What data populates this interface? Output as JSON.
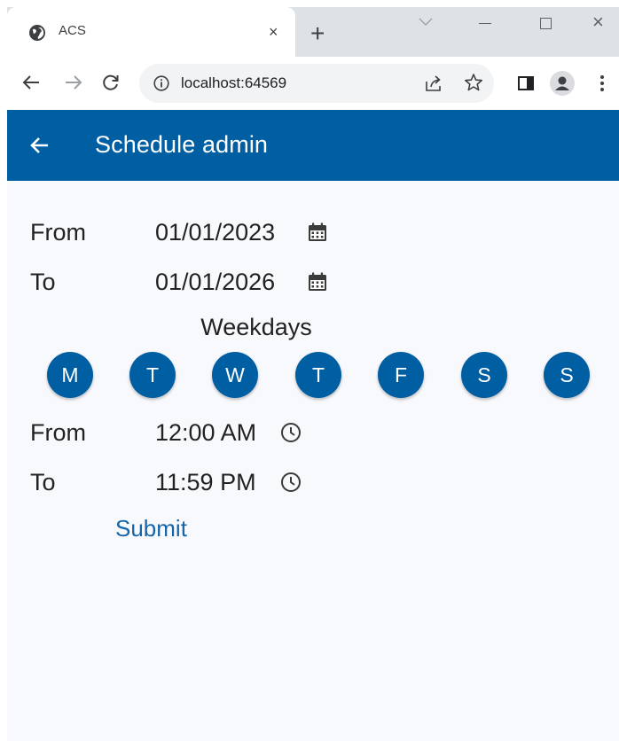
{
  "browser": {
    "tab_title": "ACS",
    "tab_close": "×",
    "new_tab": "+",
    "window_close": "×",
    "url": "localhost:64569"
  },
  "app": {
    "title": "Schedule admin",
    "date_from": {
      "label": "From",
      "value": "01/01/2023",
      "icon": "calendar-icon"
    },
    "date_to": {
      "label": "To",
      "value": "01/01/2026",
      "icon": "calendar-icon"
    },
    "weekdays": {
      "title": "Weekdays",
      "days": [
        "M",
        "T",
        "W",
        "T",
        "F",
        "S",
        "S"
      ]
    },
    "time_from": {
      "label": "From",
      "value": "12:00 AM",
      "icon": "clock-icon"
    },
    "time_to": {
      "label": "To",
      "value": "11:59 PM",
      "icon": "clock-icon"
    },
    "submit_label": "Submit"
  },
  "colors": {
    "primary": "#005ea3",
    "link": "#1565a8",
    "background": "#f8f9fc"
  }
}
